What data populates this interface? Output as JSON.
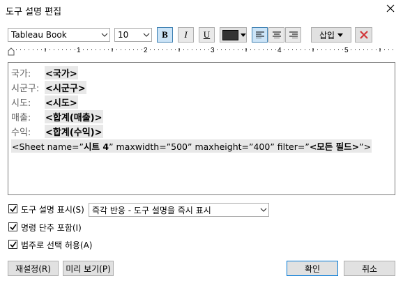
{
  "dialog": {
    "title": "도구 설명 편집"
  },
  "toolbar": {
    "font_family": "Tableau Book",
    "font_size": "10",
    "bold_label": "B",
    "italic_label": "I",
    "underline_label": "U",
    "font_color": "#333333",
    "insert_label": "삽입",
    "accent_red": "#d13438"
  },
  "ruler": {
    "ticks": [
      "1",
      "2",
      "3",
      "4",
      "5"
    ]
  },
  "editor": {
    "lines": [
      {
        "label": "국가:",
        "field": "<국가>"
      },
      {
        "label": "시군구:",
        "field": "<시군구>"
      },
      {
        "label": "시도:",
        "field": "<시도>"
      },
      {
        "label": "매출:",
        "field": "<합계(매출)>"
      },
      {
        "label": "수익:",
        "field": "<합계(수익)>"
      }
    ],
    "sheet_line": {
      "prefix": "<Sheet name=”",
      "name": "시트 4",
      "middle": "” maxwidth=”500” maxheight=”400” filter=”",
      "filter": "<모든 필드>",
      "suffix": "”>"
    }
  },
  "options": {
    "show_tooltip_label": "도구 설명 표시(S)",
    "show_tooltip_checked": true,
    "tooltip_mode": "즉각 반응 - 도구 설명을 즉시 표시",
    "command_buttons_label": "명령 단추 포함(I)",
    "command_buttons_checked": true,
    "category_select_label": "범주로 선택 허용(A)",
    "category_select_checked": true
  },
  "buttons": {
    "reset": "재설정(R)",
    "preview": "미리 보기(P)",
    "ok": "확인",
    "cancel": "취소"
  }
}
